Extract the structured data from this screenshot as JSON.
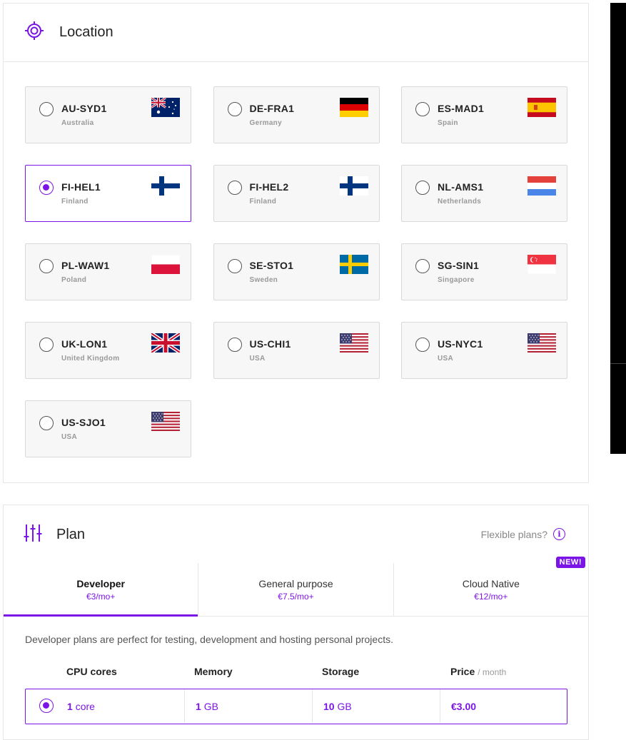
{
  "location": {
    "title": "Location",
    "icon": "target-icon",
    "regions": [
      {
        "code": "AU-SYD1",
        "country": "Australia",
        "flag": "au",
        "selected": false
      },
      {
        "code": "DE-FRA1",
        "country": "Germany",
        "flag": "de",
        "selected": false
      },
      {
        "code": "ES-MAD1",
        "country": "Spain",
        "flag": "es",
        "selected": false
      },
      {
        "code": "FI-HEL1",
        "country": "Finland",
        "flag": "fi",
        "selected": true
      },
      {
        "code": "FI-HEL2",
        "country": "Finland",
        "flag": "fi",
        "selected": false
      },
      {
        "code": "NL-AMS1",
        "country": "Netherlands",
        "flag": "nl",
        "selected": false
      },
      {
        "code": "PL-WAW1",
        "country": "Poland",
        "flag": "pl",
        "selected": false
      },
      {
        "code": "SE-STO1",
        "country": "Sweden",
        "flag": "se",
        "selected": false
      },
      {
        "code": "SG-SIN1",
        "country": "Singapore",
        "flag": "sg",
        "selected": false
      },
      {
        "code": "UK-LON1",
        "country": "United Kingdom",
        "flag": "uk",
        "selected": false
      },
      {
        "code": "US-CHI1",
        "country": "USA",
        "flag": "us",
        "selected": false
      },
      {
        "code": "US-NYC1",
        "country": "USA",
        "flag": "us",
        "selected": false
      },
      {
        "code": "US-SJO1",
        "country": "USA",
        "flag": "us",
        "selected": false
      }
    ]
  },
  "plan": {
    "title": "Plan",
    "icon": "sliders-icon",
    "flexible_label": "Flexible plans?",
    "tabs": [
      {
        "name": "Developer",
        "price": "€3/mo+",
        "active": true,
        "badge": ""
      },
      {
        "name": "General purpose",
        "price": "€7.5/mo+",
        "active": false,
        "badge": ""
      },
      {
        "name": "Cloud Native",
        "price": "€12/mo+",
        "active": false,
        "badge": "NEW!"
      }
    ],
    "description": "Developer plans are perfect for testing, development and hosting personal projects.",
    "columns": {
      "cpu": "CPU cores",
      "memory": "Memory",
      "storage": "Storage",
      "price": "Price",
      "price_unit": "/ month"
    },
    "rows": [
      {
        "cpu_value": "1",
        "cpu_unit": "core",
        "memory_value": "1",
        "memory_unit": "GB",
        "storage_value": "10",
        "storage_unit": "GB",
        "price": "€3.00",
        "selected": true
      }
    ]
  },
  "colors": {
    "accent": "#7b14e6",
    "tile_bg": "#f7f7f7",
    "border": "#d9d9d9"
  }
}
